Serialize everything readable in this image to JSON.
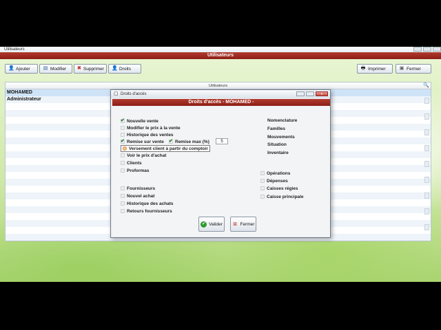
{
  "main_window": {
    "title": "Utilisateurs",
    "header": "Utilisateurs"
  },
  "toolbar": {
    "add_label": "Ajouter",
    "edit_label": "Modifier",
    "delete_label": "Supprimer",
    "rights_label": "Droits",
    "print_label": "Imprimer",
    "close_label": "Fermer"
  },
  "grid": {
    "column_header": "Utilisateurs",
    "rows": [
      "MOHAMED",
      "Administrateur"
    ]
  },
  "dialog": {
    "title": "Droits d'accès",
    "header": "Droits d'accès - MOHAMED -",
    "left_permissions": [
      {
        "label": "Nouvelle vente",
        "checked": true
      },
      {
        "label": "Modifier le prix à la vente",
        "checked": false
      },
      {
        "label": "Historique des ventes",
        "checked": false
      },
      {
        "label": "Remise sur vente",
        "checked": true
      },
      {
        "label": "Versement client à partir du comptoir",
        "checked": false
      },
      {
        "label": "Voir le prix d'achat",
        "checked": false
      },
      {
        "label": "Clients",
        "checked": false
      },
      {
        "label": "Proformas",
        "checked": false
      },
      {
        "label": "Fournisseurs",
        "checked": false
      },
      {
        "label": "Nouvel achat",
        "checked": false
      },
      {
        "label": "Historique des achats",
        "checked": false
      },
      {
        "label": "Retours fournisseurs",
        "checked": false
      }
    ],
    "discount_max": {
      "label": "Remise max (%)",
      "checked": true,
      "value": "5"
    },
    "right_permissions_top": [
      {
        "label": "Nomenclature"
      },
      {
        "label": "Familles"
      },
      {
        "label": "Mouvements"
      },
      {
        "label": "Situation"
      },
      {
        "label": "Inventaire"
      }
    ],
    "right_permissions_bottom": [
      {
        "label": "Opérations"
      },
      {
        "label": "Dépenses"
      },
      {
        "label": "Caisses régies"
      },
      {
        "label": "Caisse principale"
      }
    ],
    "validate_label": "Valider",
    "close_label": "Fermer"
  }
}
